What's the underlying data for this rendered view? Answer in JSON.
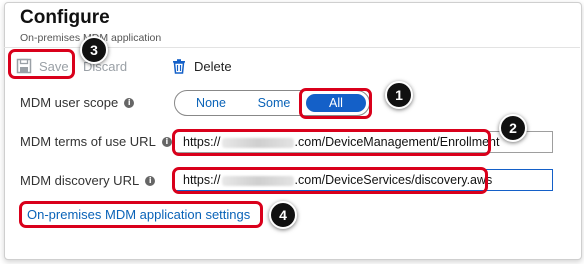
{
  "header": {
    "title": "Configure",
    "subtitle": "On-premises MDM application"
  },
  "toolbar": {
    "save_label": "Save",
    "discard_label": "Discard",
    "delete_label": "Delete",
    "save_icon": "save-icon",
    "delete_icon": "trash-icon"
  },
  "form": {
    "scope": {
      "label": "MDM user scope",
      "options": [
        "None",
        "Some",
        "All"
      ],
      "selected": "All"
    },
    "terms_url": {
      "label": "MDM terms of use URL",
      "value_prefix": "https://",
      "value_suffix": ".com/DeviceManagement/Enrollment"
    },
    "discovery_url": {
      "label": "MDM discovery URL",
      "value_prefix": "https://",
      "value_suffix": ".com/DeviceServices/discovery.aws"
    },
    "settings_link": "On-premises MDM application settings"
  },
  "annotations": {
    "callouts": [
      "1",
      "2",
      "3",
      "4"
    ],
    "highlight_color": "#d9001b"
  },
  "colors": {
    "accent": "#1460c8",
    "link": "#0a63b8"
  }
}
